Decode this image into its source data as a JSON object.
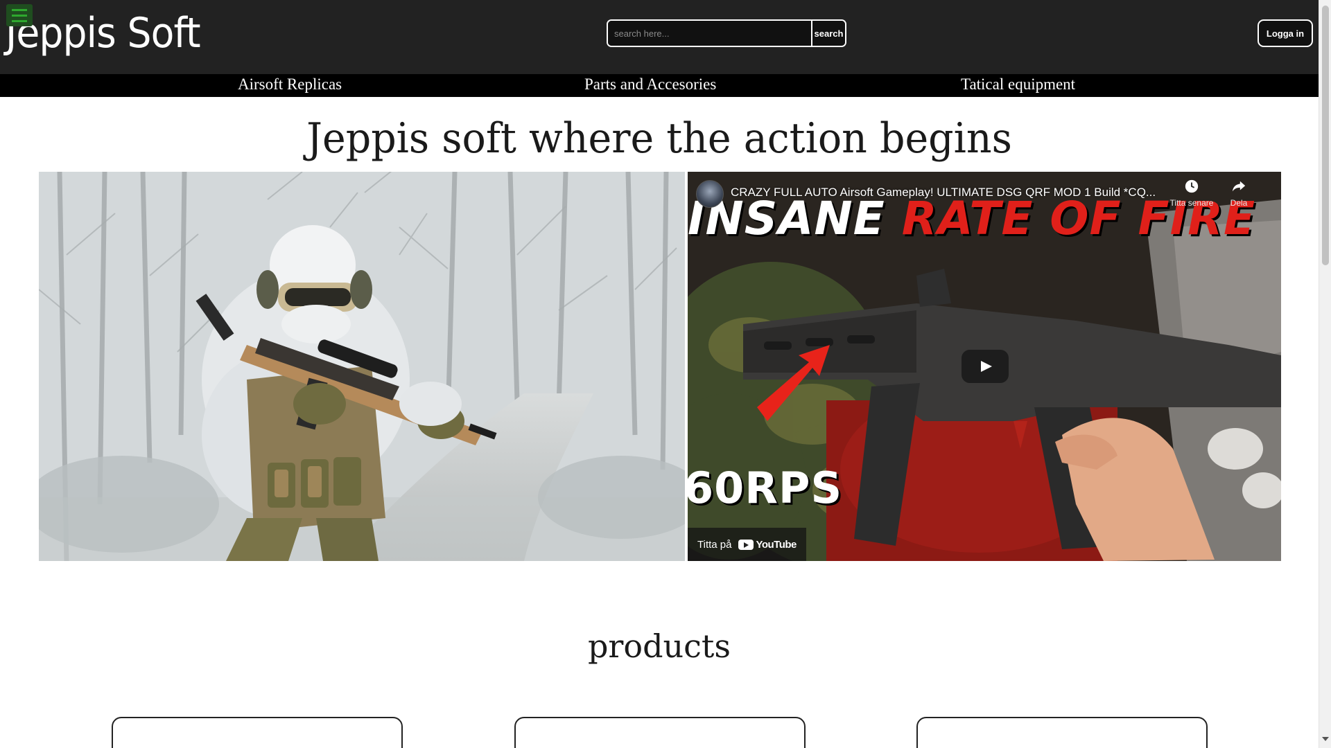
{
  "header": {
    "logo_text": "Jeppis Soft",
    "menu_icon": "hamburger-menu-icon",
    "search": {
      "placeholder": "search here...",
      "value": "",
      "button_label": "search"
    },
    "login_label": "Logga in",
    "colors": {
      "background": "#222222",
      "menu_icon": "#2ea82e"
    }
  },
  "nav": {
    "items": [
      {
        "label": "Airsoft Replicas"
      },
      {
        "label": "Parts and Accesories"
      },
      {
        "label": "Tatical equipment"
      }
    ],
    "background": "#000000"
  },
  "hero": {
    "title": "Jeppis soft where the action begins"
  },
  "video": {
    "title": "CRAZY FULL AUTO Airsoft Gameplay! ULTIMATE DSG QRF MOD 1 Build *CQ...",
    "thumbnail_text_white": "INSANE ",
    "thumbnail_text_highlight": "RATE OF FIRE",
    "thumbnail_caption": "60RPS",
    "watch_later_label": "Titta senare",
    "share_label": "Dela",
    "watch_on_label": "Titta på",
    "platform_label": "YouTube",
    "colors": {
      "play_button": "#191919",
      "highlight_text": "#e0201a"
    }
  },
  "products": {
    "title": "products",
    "cards": [
      {
        "id": "card-1"
      },
      {
        "id": "card-2"
      },
      {
        "id": "card-3"
      }
    ]
  }
}
